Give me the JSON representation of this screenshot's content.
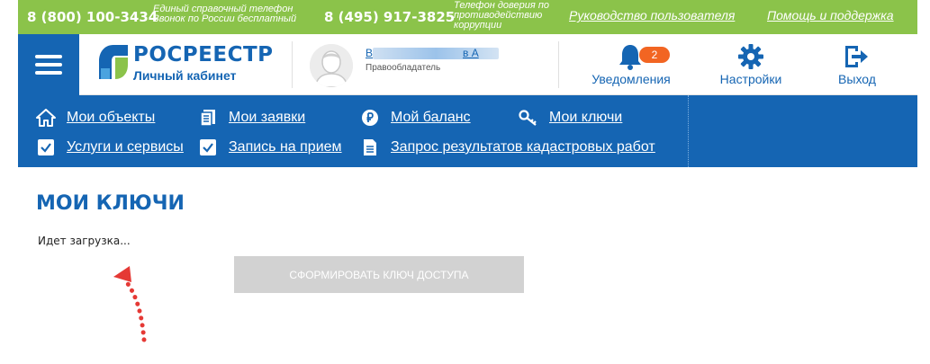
{
  "topbar": {
    "phone1": "8 (800) 100-3434",
    "phone1_note_line1": "Единый справочный телефон",
    "phone1_note_line2": "Звонок по России бесплатный",
    "phone2": "8 (495) 917-3825",
    "phone2_note_line1": "Телефон доверия по",
    "phone2_note_line2": "противодействию",
    "phone2_note_line3": "коррупции",
    "guide_link": "Руководство пользователя",
    "help_link": "Помощь и поддержка"
  },
  "header": {
    "logo_name": "РОСРЕЕСТР",
    "logo_sub": "Личный кабинет",
    "user_name_visible_start": "В",
    "user_name_visible_mid": "в А",
    "user_role": "Правообладатель",
    "notifications_label": "Уведомления",
    "notifications_count": "2",
    "settings_label": "Настройки",
    "logout_label": "Выход"
  },
  "menu": {
    "items": [
      {
        "label": "Мои объекты",
        "icon": "home-icon"
      },
      {
        "label": "Мои заявки",
        "icon": "documents-icon"
      },
      {
        "label": "Мой баланс",
        "icon": "ruble-icon"
      },
      {
        "label": "Мои ключи",
        "icon": "key-icon"
      },
      {
        "label": "Услуги и сервисы",
        "icon": "checkbox-icon"
      },
      {
        "label": "Запись на прием",
        "icon": "checkbox-icon"
      },
      {
        "label": "Запрос результатов кадастровых работ",
        "icon": "document-icon"
      }
    ]
  },
  "main": {
    "title": "МОИ КЛЮЧИ",
    "loading_text": "Идет загрузка...",
    "generate_button": "Сформировать ключ доступа"
  },
  "colors": {
    "green": "#8bc34a",
    "brand_blue": "#1565b3",
    "badge_orange": "#f26522",
    "disabled_gray": "#d2d2d2",
    "annotation_red": "#e53935"
  }
}
